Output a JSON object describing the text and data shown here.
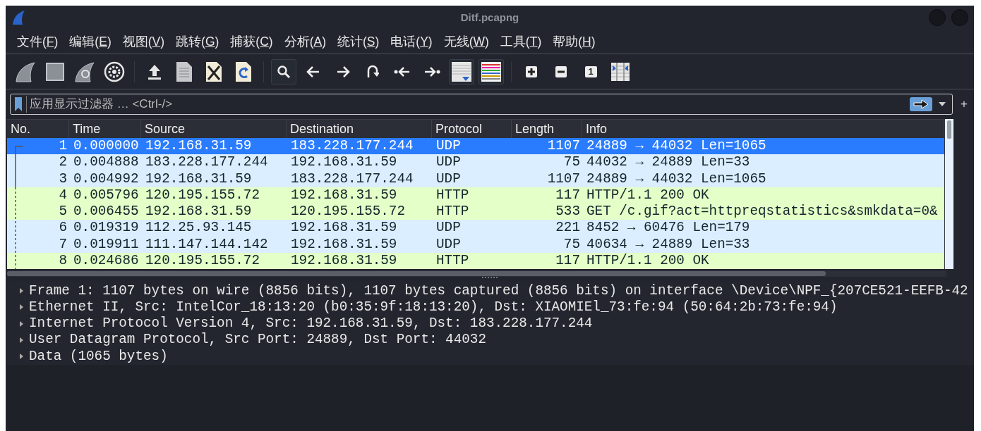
{
  "window": {
    "title": "Ditf.pcapng"
  },
  "menu": [
    {
      "before": "文件(",
      "key": "F",
      "after": ")"
    },
    {
      "before": "编辑(",
      "key": "E",
      "after": ")"
    },
    {
      "before": "视图(",
      "key": "V",
      "after": ")"
    },
    {
      "before": "跳转(",
      "key": "G",
      "after": ")"
    },
    {
      "before": "捕获(",
      "key": "C",
      "after": ")"
    },
    {
      "before": "分析(",
      "key": "A",
      "after": ")"
    },
    {
      "before": "统计(",
      "key": "S",
      "after": ")"
    },
    {
      "before": "电话(",
      "key": "Y",
      "after": ")"
    },
    {
      "before": "无线(",
      "key": "W",
      "after": ")"
    },
    {
      "before": "工具(",
      "key": "T",
      "after": ")"
    },
    {
      "before": "帮助(",
      "key": "H",
      "after": ")"
    }
  ],
  "toolbar": {
    "zoom_reset_label": "1"
  },
  "filter": {
    "placeholder": "应用显示过滤器 … <Ctrl-/>",
    "add_button": "+"
  },
  "packet_list": {
    "columns": [
      "No.",
      "Time",
      "Source",
      "Destination",
      "Protocol",
      "Length",
      "Info"
    ],
    "rows": [
      {
        "no": "1",
        "time": "0.000000",
        "source": "192.168.31.59",
        "destination": "183.228.177.244",
        "protocol": "UDP",
        "length": "1107",
        "info": "24889 → 44032 Len=1065",
        "selected": true
      },
      {
        "no": "2",
        "time": "0.004888",
        "source": "183.228.177.244",
        "destination": "192.168.31.59",
        "protocol": "UDP",
        "length": "75",
        "info": "44032 → 24889 Len=33",
        "color": "#daeeff",
        "selected": false
      },
      {
        "no": "3",
        "time": "0.004992",
        "source": "192.168.31.59",
        "destination": "183.228.177.244",
        "protocol": "UDP",
        "length": "1107",
        "info": "24889 → 44032 Len=1065",
        "color": "#daeeff",
        "selected": false
      },
      {
        "no": "4",
        "time": "0.005796",
        "source": "120.195.155.72",
        "destination": "192.168.31.59",
        "protocol": "HTTP",
        "length": "117",
        "info": "HTTP/1.1 200 OK",
        "color": "#e4ffc7",
        "selected": false
      },
      {
        "no": "5",
        "time": "0.006455",
        "source": "192.168.31.59",
        "destination": "120.195.155.72",
        "protocol": "HTTP",
        "length": "533",
        "info": "GET /c.gif?act=httpreqstatistics&smkdata=0&",
        "color": "#e4ffc7",
        "selected": false
      },
      {
        "no": "6",
        "time": "0.019319",
        "source": "112.25.93.145",
        "destination": "192.168.31.59",
        "protocol": "UDP",
        "length": "221",
        "info": "8452 → 60476 Len=179",
        "color": "#daeeff",
        "selected": false
      },
      {
        "no": "7",
        "time": "0.019911",
        "source": "111.147.144.142",
        "destination": "192.168.31.59",
        "protocol": "UDP",
        "length": "75",
        "info": "40634 → 24889 Len=33",
        "color": "#daeeff",
        "selected": false
      },
      {
        "no": "8",
        "time": "0.024686",
        "source": "120.195.155.72",
        "destination": "192.168.31.59",
        "protocol": "HTTP",
        "length": "117",
        "info": "HTTP/1.1 200 OK",
        "color": "#e4ffc7",
        "selected": false
      }
    ]
  },
  "details": [
    {
      "text": "Frame 1: 1107 bytes on wire (8856 bits), 1107 bytes captured (8856 bits) on interface \\Device\\NPF_{207CE521-EEFB-42",
      "expanded": false
    },
    {
      "text": "Ethernet II, Src: IntelCor_18:13:20 (b0:35:9f:18:13:20), Dst: XIAOMIEl_73:fe:94 (50:64:2b:73:fe:94)",
      "expanded": false
    },
    {
      "text": "Internet Protocol Version 4, Src: 192.168.31.59, Dst: 183.228.177.244",
      "expanded": false
    },
    {
      "text": "User Datagram Protocol, Src Port: 24889, Dst Port: 44032",
      "expanded": false
    },
    {
      "text": "Data (1065 bytes)",
      "expanded": false
    }
  ]
}
